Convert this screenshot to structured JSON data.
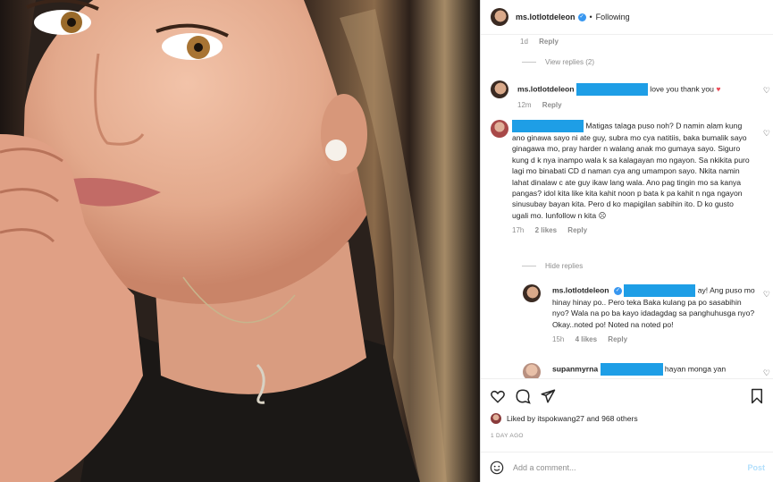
{
  "post": {
    "username": "ms.lotlotdeleon",
    "follow_status": "Following",
    "separator": "•"
  },
  "comments": {
    "top": {
      "time": "1d",
      "reply_label": "Reply"
    },
    "view_replies": "View replies (2)",
    "c1": {
      "username": "ms.lotlotdeleon",
      "text": "love you thank you",
      "time": "12m",
      "reply_label": "Reply"
    },
    "c2": {
      "text": "Matigas talaga puso noh? D namin alam kung ano ginawa sayo ni ate guy, subra mo cya natitiis, baka bumalik sayo ginagawa mo, pray harder n walang anak mo gumaya sayo. Siguro kung d k nya inampo wala k sa kalagayan mo ngayon. Sa nkikita puro lagi mo binabati CD d naman cya ang umampon sayo. Nkita namin lahat dinalaw c ate guy ikaw lang wala. Ano pag tingin mo sa kanya pangas? idol kita like kita kahit noon p bata k pa kahit n nga ngayon sinusubay bayan kita. Pero d ko mapigilan sabihin ito. D ko gusto ugali mo. Iunfollow n kita",
      "time": "17h",
      "likes": "2 likes",
      "reply_label": "Reply"
    },
    "hide_replies": "Hide replies",
    "c3": {
      "username": "ms.lotlotdeleon",
      "text": "ay! Ang puso mo hinay hinay po.. Pero teka Baka kulang pa po sasabihin nyo? Wala na po ba kayo idadagdag sa panghuhusga nyo? Okay..noted po! Noted na noted po!",
      "time": "15h",
      "likes": "4 likes",
      "reply_label": "Reply"
    },
    "c4": {
      "username": "supanmyrna",
      "text": "hayan monga yan"
    }
  },
  "actions": {
    "liked_by_prefix": "Liked by",
    "liked_by_user": "itspokwang27",
    "liked_by_suffix": "and 968 others",
    "time_ago": "1 DAY AGO",
    "comment_placeholder": "Add a comment...",
    "post_label": "Post"
  },
  "icons": {
    "like": "heart-icon",
    "comment": "comment-icon",
    "share": "share-icon",
    "save": "bookmark-icon",
    "emoji": "emoji-icon",
    "more": "more-icon"
  },
  "colors": {
    "redaction": "#1e9ee6",
    "verified": "#3897f0",
    "post_disabled": "#b2dffc",
    "heart_red": "#ed4956"
  }
}
